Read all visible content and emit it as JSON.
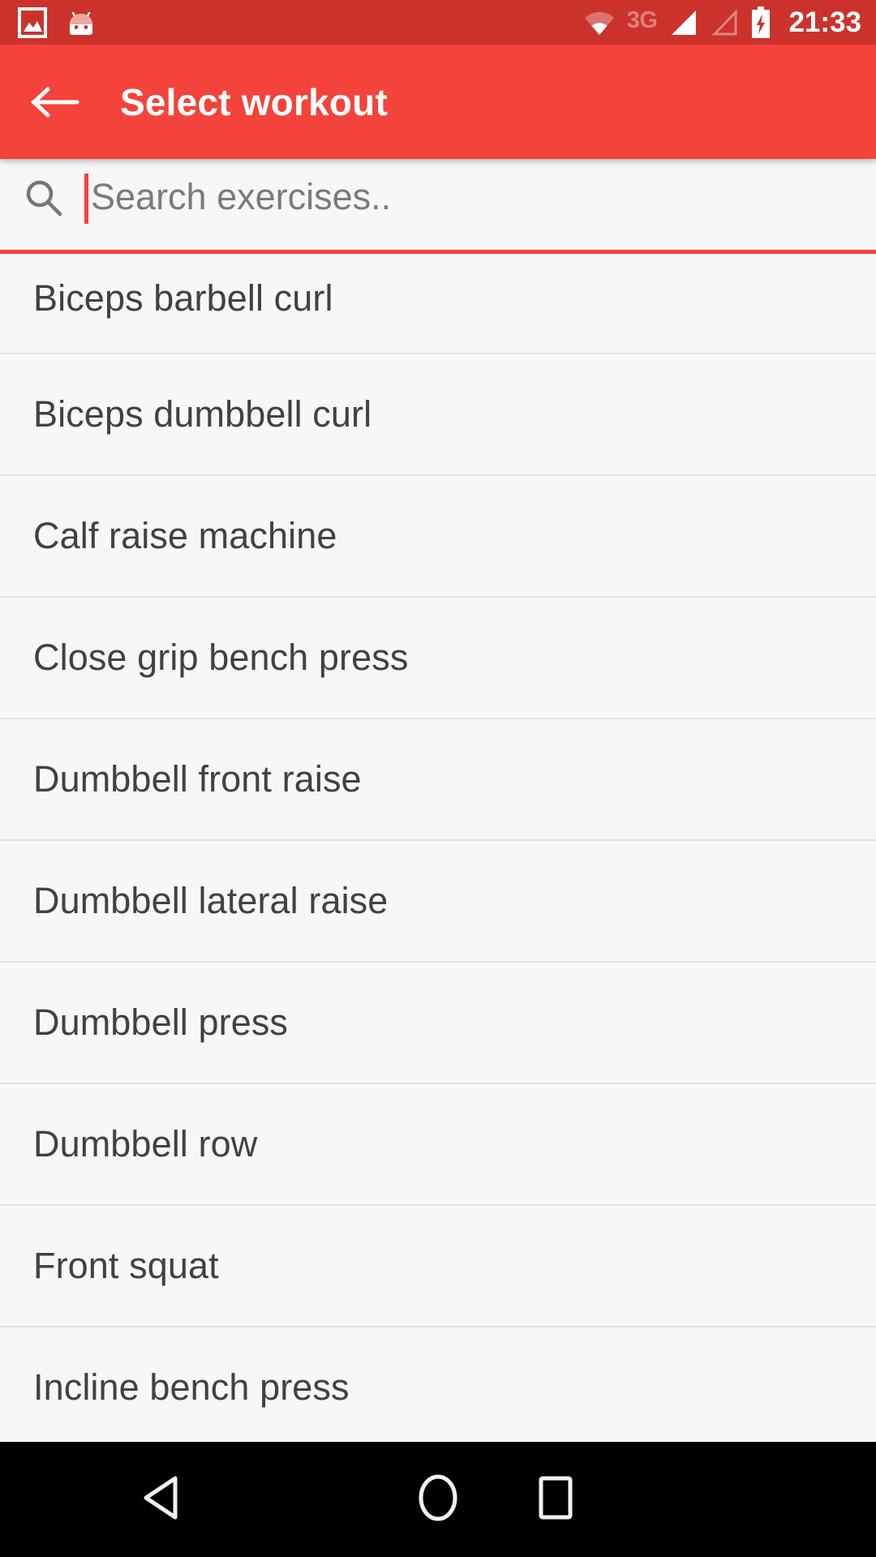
{
  "status_bar": {
    "time": "21:33",
    "network_label": "3G",
    "icons": [
      {
        "name": "photo-icon",
        "state": "white"
      },
      {
        "name": "android-head-icon",
        "state": "white"
      },
      {
        "name": "wifi-icon",
        "state": "dimmed"
      },
      {
        "name": "signal-bars-icon",
        "state": "white"
      },
      {
        "name": "signal-bars-secondary-icon",
        "state": "dimmed"
      },
      {
        "name": "battery-charging-icon",
        "state": "white"
      }
    ],
    "background_color": "#CC322C",
    "text_color": "#FFFFFF"
  },
  "app_bar": {
    "title": "Select workout",
    "back_icon": "arrow-back-icon",
    "background_color": "#F4433A",
    "text_color": "#FFFFFF"
  },
  "search": {
    "icon": "search-icon",
    "value": "",
    "placeholder": "Search exercises..",
    "focused": true,
    "underline_color": "#F4433A",
    "caret_color": "#F4433A"
  },
  "list": {
    "background_color": "#F7F7F7",
    "divider_color": "#E2E2E2",
    "text_color": "#414141",
    "items": [
      {
        "label": "Biceps barbell curl",
        "clipped_top": true
      },
      {
        "label": "Biceps dumbbell curl"
      },
      {
        "label": "Calf raise machine"
      },
      {
        "label": "Close grip bench press"
      },
      {
        "label": "Dumbbell front raise"
      },
      {
        "label": "Dumbbell lateral raise"
      },
      {
        "label": "Dumbbell press"
      },
      {
        "label": "Dumbbell row"
      },
      {
        "label": "Front squat"
      },
      {
        "label": "Incline bench press"
      }
    ]
  },
  "nav_bar": {
    "background_color": "#000000",
    "buttons": [
      {
        "name": "nav-back-button",
        "icon": "triangle-back-icon"
      },
      {
        "name": "nav-home-button",
        "icon": "circle-home-icon"
      },
      {
        "name": "nav-recents-button",
        "icon": "square-recents-icon"
      }
    ]
  }
}
